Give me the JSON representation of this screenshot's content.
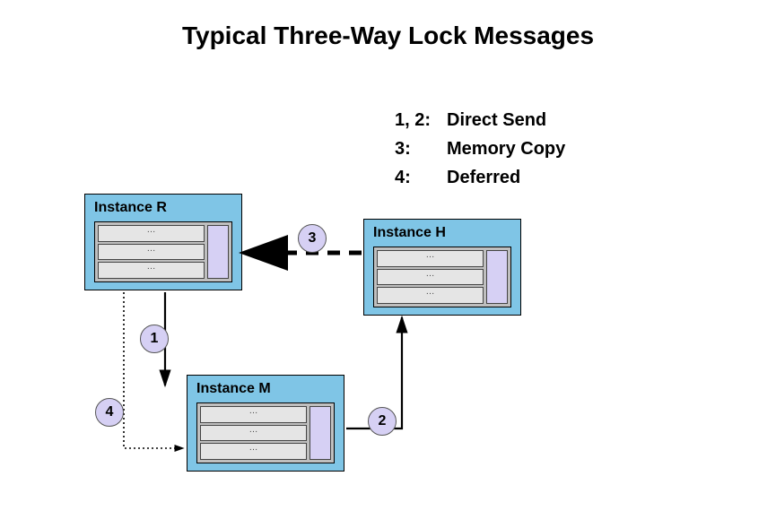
{
  "title": "Typical Three-Way Lock Messages",
  "legend": [
    {
      "key": "1, 2:",
      "value": "Direct Send"
    },
    {
      "key": "3:",
      "value": "Memory Copy"
    },
    {
      "key": "4:",
      "value": "Deferred"
    }
  ],
  "nodes": {
    "R": {
      "label": "Instance R",
      "rows": [
        "…",
        "…",
        "…"
      ]
    },
    "H": {
      "label": "Instance H",
      "rows": [
        "…",
        "…",
        "…"
      ]
    },
    "M": {
      "label": "Instance M",
      "rows": [
        "…",
        "…",
        "…"
      ]
    }
  },
  "badges": {
    "b1": "1",
    "b2": "2",
    "b3": "3",
    "b4": "4"
  }
}
